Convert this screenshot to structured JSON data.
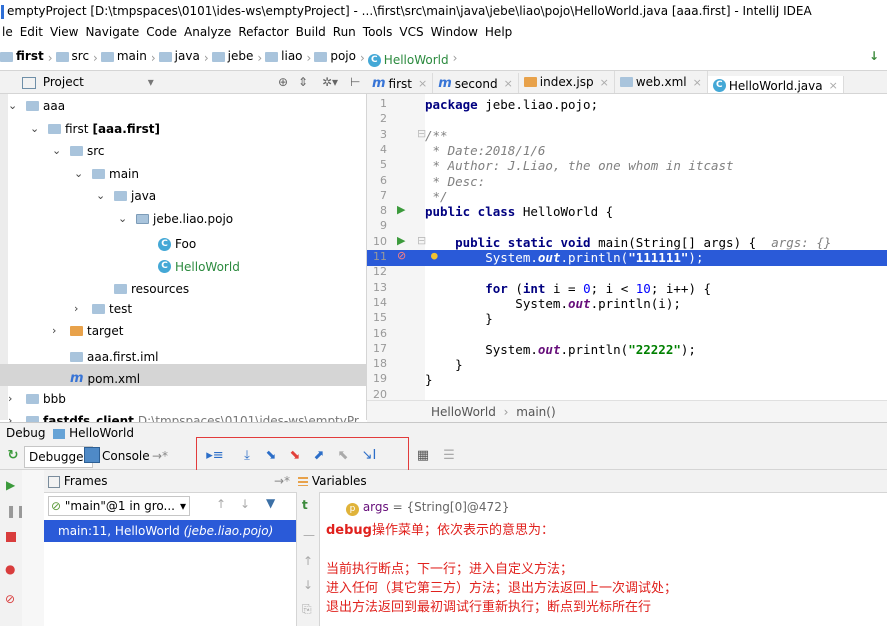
{
  "window": {
    "title": "emptyProject [D:\\tmpspaces\\0101\\ides-ws\\emptyProject] - ...\\first\\src\\main\\java\\jebe\\liao\\pojo\\HelloWorld.java [aaa.first] - IntelliJ IDEA"
  },
  "menu": [
    "le",
    "Edit",
    "View",
    "Navigate",
    "Code",
    "Analyze",
    "Refactor",
    "Build",
    "Run",
    "Tools",
    "VCS",
    "Window",
    "Help"
  ],
  "breadcrumb": [
    "first",
    "src",
    "main",
    "java",
    "jebe",
    "liao",
    "pojo",
    "HelloWorld"
  ],
  "project": {
    "header": "Project",
    "tree": [
      {
        "label": "aaa",
        "indent": 0,
        "arrow": "v"
      },
      {
        "label": "first",
        "suffix": "[aaa.first]",
        "indent": 1,
        "arrow": "v"
      },
      {
        "label": "src",
        "indent": 2,
        "arrow": "v"
      },
      {
        "label": "main",
        "indent": 3,
        "arrow": "v"
      },
      {
        "label": "java",
        "indent": 4,
        "arrow": "v"
      },
      {
        "label": "jebe.liao.pojo",
        "indent": 5,
        "arrow": "v"
      },
      {
        "label": "Foo",
        "indent": 6,
        "arrow": ""
      },
      {
        "label": "HelloWorld",
        "indent": 6,
        "arrow": ""
      },
      {
        "label": "resources",
        "indent": 4,
        "arrow": ""
      },
      {
        "label": "test",
        "indent": 3,
        "arrow": ">"
      },
      {
        "label": "target",
        "indent": 2,
        "arrow": ">"
      },
      {
        "label": "aaa.first.iml",
        "indent": 2,
        "arrow": ""
      },
      {
        "label": "pom.xml",
        "indent": 2,
        "arrow": ""
      },
      {
        "label": "bbb",
        "indent": 0,
        "arrow": ">"
      },
      {
        "label": "fastdfs_client",
        "suffix": "D:\\tmpspaces\\0101\\ides-ws\\emptyPr",
        "indent": 0,
        "arrow": ">"
      }
    ]
  },
  "editor": {
    "tabs": [
      "first",
      "second",
      "index.jsp",
      "web.xml",
      "HelloWorld.java"
    ],
    "active_tab": "HelloWorld.java",
    "line_numbers": [
      "1",
      "2",
      "3",
      "4",
      "5",
      "6",
      "7",
      "8",
      "9",
      "10",
      "11",
      "12",
      "13",
      "14",
      "15",
      "16",
      "17",
      "18",
      "19",
      "20"
    ],
    "lines": [
      {
        "n": 1,
        "parts": [
          [
            "kw",
            "package "
          ],
          [
            "",
            "jebe.liao.pojo;"
          ]
        ]
      },
      {
        "n": 2,
        "parts": []
      },
      {
        "n": 3,
        "parts": [
          [
            "cm",
            "/**"
          ]
        ]
      },
      {
        "n": 4,
        "parts": [
          [
            "cm",
            " * Date:2018/1/6"
          ]
        ]
      },
      {
        "n": 5,
        "parts": [
          [
            "cm",
            " * Author: J.Liao, the one whom in itcast"
          ]
        ]
      },
      {
        "n": 6,
        "parts": [
          [
            "cm",
            " * Desc:"
          ]
        ]
      },
      {
        "n": 7,
        "parts": [
          [
            "cm",
            " */"
          ]
        ]
      },
      {
        "n": 8,
        "parts": [
          [
            "kw",
            "public class "
          ],
          [
            "",
            "HelloWorld {"
          ]
        ]
      },
      {
        "n": 9,
        "parts": []
      },
      {
        "n": 10,
        "parts": [
          [
            "",
            "    "
          ],
          [
            "kw",
            "public static void "
          ],
          [
            "",
            "main(String[] args) {  "
          ],
          [
            "cm",
            "args: {}"
          ]
        ]
      },
      {
        "n": 11,
        "parts": [
          [
            "",
            "        System."
          ],
          [
            "fld",
            "out"
          ],
          [
            "",
            ".println("
          ],
          [
            "str",
            "\"111111\""
          ],
          [
            "",
            ");"
          ]
        ],
        "highlight": true
      },
      {
        "n": 12,
        "parts": []
      },
      {
        "n": 13,
        "parts": [
          [
            "",
            "        "
          ],
          [
            "kw",
            "for "
          ],
          [
            "",
            "("
          ],
          [
            "kw",
            "int "
          ],
          [
            "",
            "i = "
          ],
          [
            "num",
            "0"
          ],
          [
            "",
            "; i < "
          ],
          [
            "num",
            "10"
          ],
          [
            "",
            "; i++) {"
          ]
        ]
      },
      {
        "n": 14,
        "parts": [
          [
            "",
            "            System."
          ],
          [
            "fld",
            "out"
          ],
          [
            "",
            ".println(i);"
          ]
        ]
      },
      {
        "n": 15,
        "parts": [
          [
            "",
            "        }"
          ]
        ]
      },
      {
        "n": 16,
        "parts": []
      },
      {
        "n": 17,
        "parts": [
          [
            "",
            "        System."
          ],
          [
            "fld",
            "out"
          ],
          [
            "",
            ".println("
          ],
          [
            "str",
            "\"22222\""
          ],
          [
            "",
            ");"
          ]
        ]
      },
      {
        "n": 18,
        "parts": [
          [
            "",
            "    }"
          ]
        ]
      },
      {
        "n": 19,
        "parts": [
          [
            "",
            "}"
          ]
        ]
      },
      {
        "n": 20,
        "parts": []
      }
    ],
    "crumb": [
      "HelloWorld",
      "main()"
    ]
  },
  "debug": {
    "title": "Debug",
    "config": "HelloWorld",
    "tabs": [
      "Debugger",
      "Console"
    ],
    "frames_label": "Frames",
    "thread_select": "\"main\"@1 in gro...",
    "frame_item": "main:11, HelloWorld",
    "frame_item_pkg": "(jebe.liao.pojo)",
    "variables_label": "Variables",
    "var_name": "args",
    "var_value": "= {String[0]@472}",
    "note_title_en": "debug",
    "note_title_cn": "操作菜单；依次表示的意思为：",
    "note_lines": [
      "当前执行断点；下一行；进入自定义方法；",
      "进入任何（其它第三方）方法；退出方法返回上一次调试处；",
      "退出方法返回到最初调试行重新执行；断点到光标所在行"
    ]
  }
}
